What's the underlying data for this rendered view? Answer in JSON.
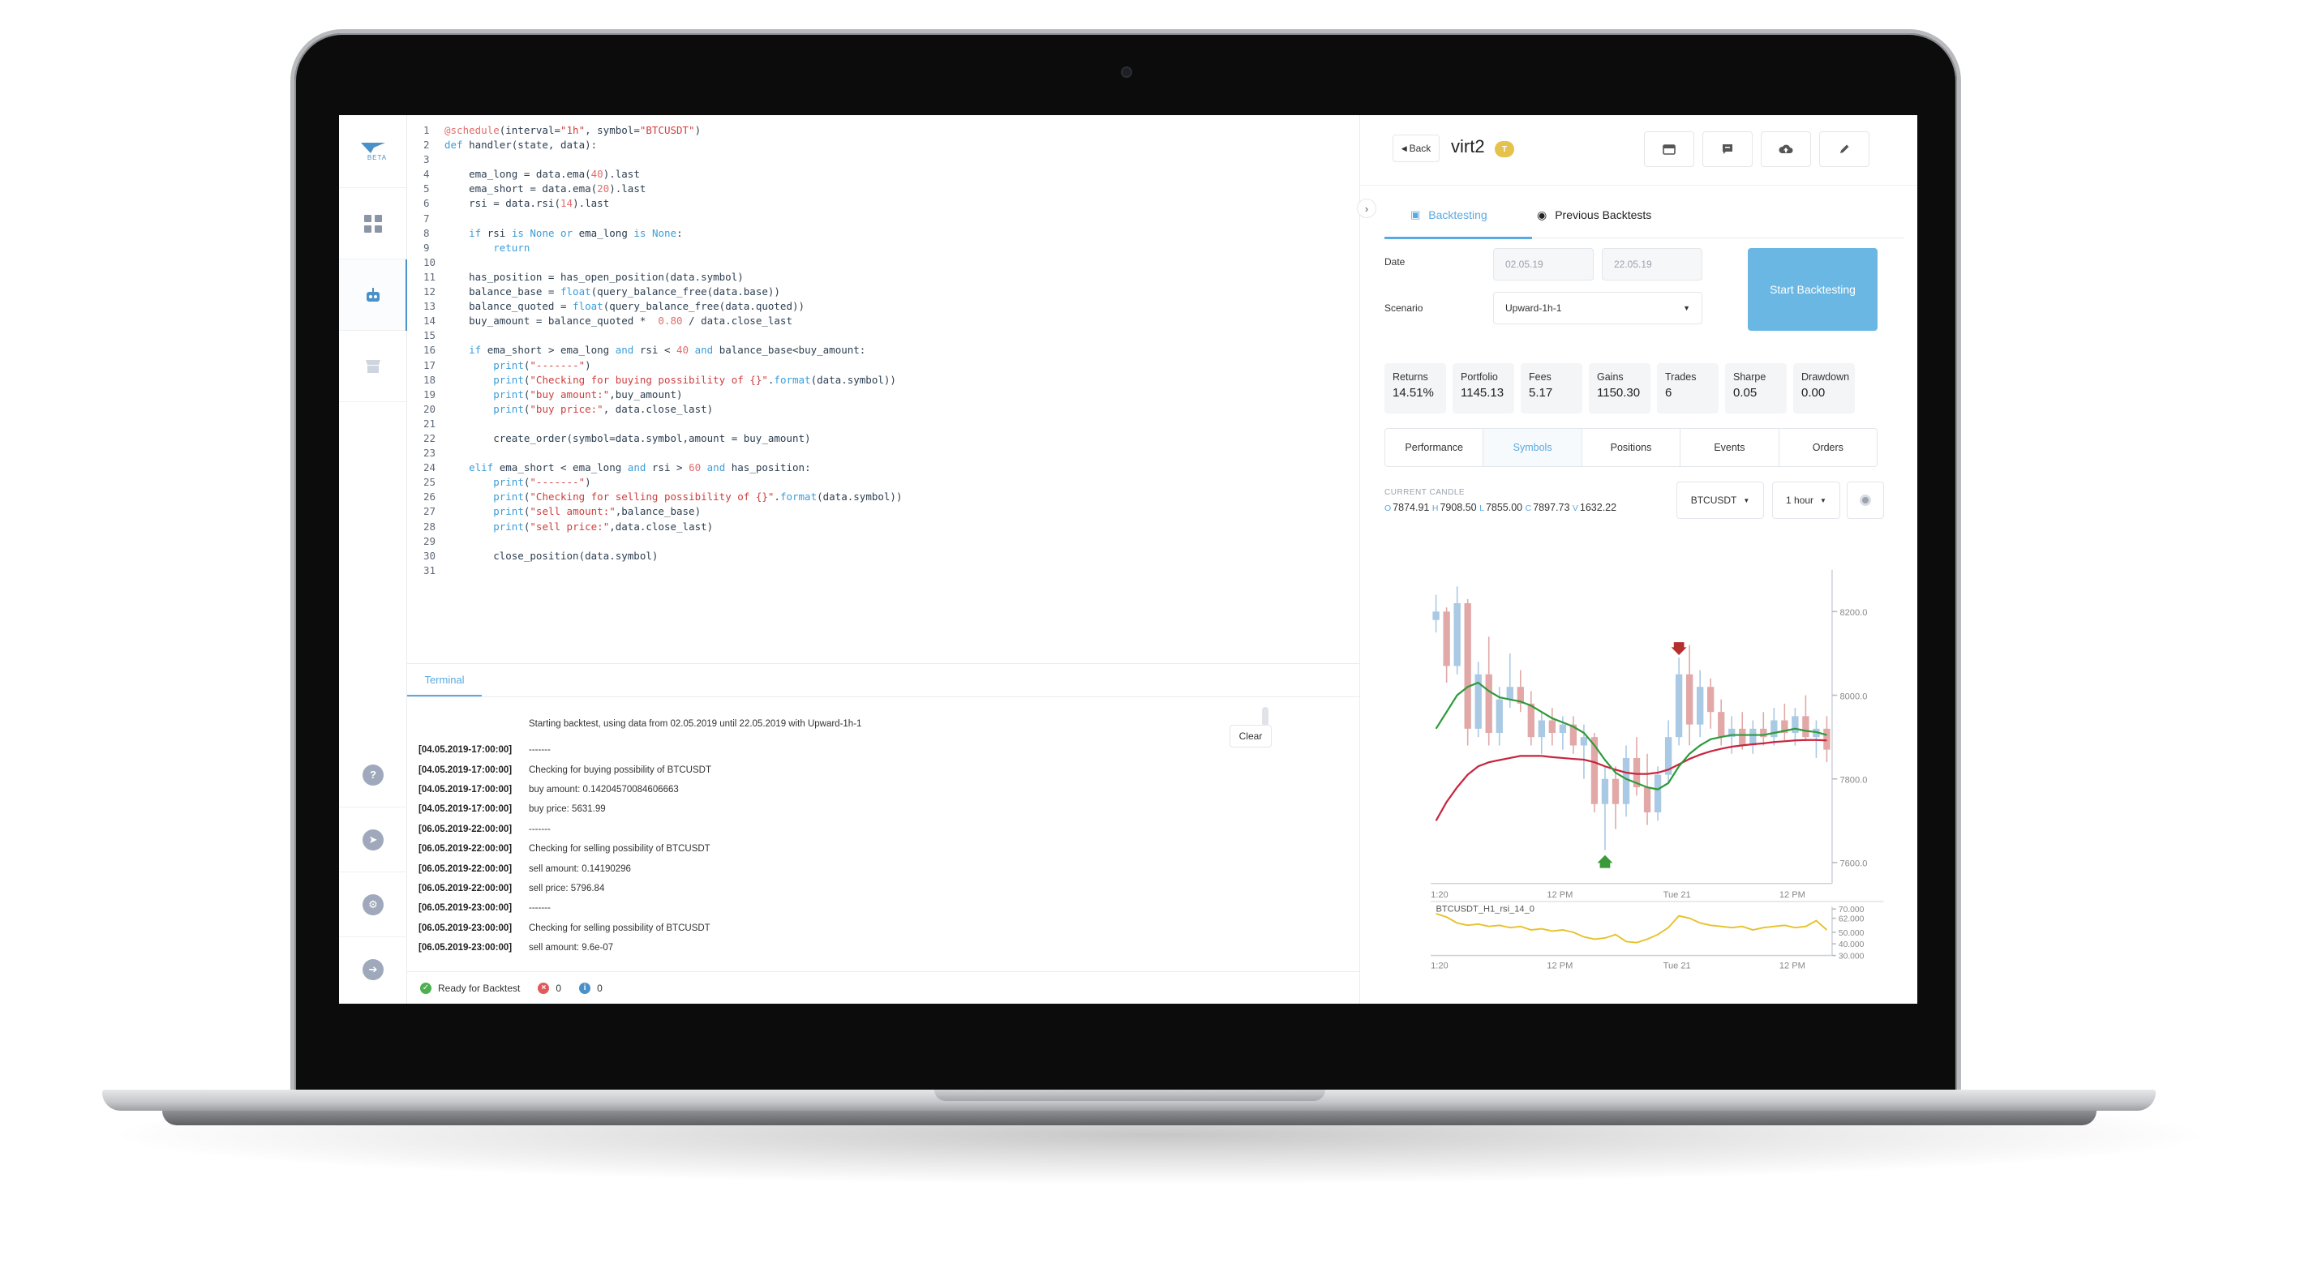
{
  "sidebar": {
    "logo_text": "BETA",
    "items": [
      {
        "icon": "dashboard-grid-icon"
      },
      {
        "icon": "robot-icon"
      },
      {
        "icon": "store-icon"
      }
    ],
    "bottom_items": [
      {
        "icon": "help-icon",
        "glyph": "?"
      },
      {
        "icon": "telegram-icon",
        "glyph": "➤"
      },
      {
        "icon": "settings-icon",
        "glyph": "⚙"
      },
      {
        "icon": "logout-icon",
        "glyph": "➔"
      }
    ]
  },
  "editor": {
    "lines": [
      "@schedule(interval=\"1h\", symbol=\"BTCUSDT\")",
      "def handler(state, data):",
      "",
      "    ema_long = data.ema(40).last",
      "    ema_short = data.ema(20).last",
      "    rsi = data.rsi(14).last",
      "",
      "    if rsi is None or ema_long is None:",
      "        return",
      "",
      "    has_position = has_open_position(data.symbol)",
      "    balance_base = float(query_balance_free(data.base))",
      "    balance_quoted = float(query_balance_free(data.quoted))",
      "    buy_amount = balance_quoted *  0.80 / data.close_last",
      "",
      "    if ema_short > ema_long and rsi < 40 and balance_base<buy_amount:",
      "        print(\"-------\")",
      "        print(\"Checking for buying possibility of {}\".format(data.symbol))",
      "        print(\"buy amount:\",buy_amount)",
      "        print(\"buy price:\", data.close_last)",
      "",
      "        create_order(symbol=data.symbol,amount = buy_amount)",
      "",
      "    elif ema_short < ema_long and rsi > 60 and has_position:",
      "        print(\"-------\")",
      "        print(\"Checking for selling possibility of {}\".format(data.symbol))",
      "        print(\"sell amount:\",balance_base)",
      "        print(\"sell price:\",data.close_last)",
      "",
      "        close_position(data.symbol)",
      ""
    ]
  },
  "terminal": {
    "tab_label": "Terminal",
    "start_message": "Starting backtest, using data from 02.05.2019 until 22.05.2019 with Upward-1h-1",
    "clear_label": "Clear",
    "lines": [
      {
        "ts": "[04.05.2019-17:00:00]",
        "msg": "-------"
      },
      {
        "ts": "[04.05.2019-17:00:00]",
        "msg": "Checking for buying possibility of BTCUSDT"
      },
      {
        "ts": "[04.05.2019-17:00:00]",
        "msg": "buy amount: 0.14204570084606663"
      },
      {
        "ts": "[04.05.2019-17:00:00]",
        "msg": "buy price: 5631.99"
      },
      {
        "ts": "[06.05.2019-22:00:00]",
        "msg": "-------"
      },
      {
        "ts": "[06.05.2019-22:00:00]",
        "msg": "Checking for selling possibility of BTCUSDT"
      },
      {
        "ts": "[06.05.2019-22:00:00]",
        "msg": "sell amount: 0.14190296"
      },
      {
        "ts": "[06.05.2019-22:00:00]",
        "msg": "sell price: 5796.84"
      },
      {
        "ts": "[06.05.2019-23:00:00]",
        "msg": "-------"
      },
      {
        "ts": "[06.05.2019-23:00:00]",
        "msg": "Checking for selling possibility of BTCUSDT"
      },
      {
        "ts": "[06.05.2019-23:00:00]",
        "msg": "sell amount: 9.6e-07"
      }
    ]
  },
  "status": {
    "ready_label": "Ready for Backtest",
    "error_count": "0",
    "info_count": "0",
    "colors": {
      "ok": "#4caf50",
      "error": "#e05a5a",
      "info": "#4a90c9"
    }
  },
  "panel": {
    "back_label": "Back",
    "bot_name": "virt2",
    "bot_badge": "T",
    "toolbar_icons": [
      "calendar-icon",
      "comment-icon",
      "cloud-upload-icon",
      "edit-icon"
    ],
    "tabs": [
      {
        "label": "Backtesting",
        "icon": "backtest-icon",
        "active": true
      },
      {
        "label": "Previous Backtests",
        "icon": "history-icon",
        "active": false
      }
    ],
    "date_label": "Date",
    "date_from": "02.05.19",
    "date_to": "22.05.19",
    "scenario_label": "Scenario",
    "scenario_value": "Upward-1h-1",
    "start_button": "Start Backtesting",
    "metrics": [
      {
        "label": "Returns",
        "value": "14.51%"
      },
      {
        "label": "Portfolio",
        "value": "1145.13"
      },
      {
        "label": "Fees",
        "value": "5.17"
      },
      {
        "label": "Gains",
        "value": "1150.30"
      },
      {
        "label": "Trades",
        "value": "6"
      },
      {
        "label": "Sharpe",
        "value": "0.05"
      },
      {
        "label": "Drawdown",
        "value": "0.00"
      }
    ],
    "subtabs": [
      {
        "label": "Performance",
        "active": false
      },
      {
        "label": "Symbols",
        "active": true
      },
      {
        "label": "Positions",
        "active": false
      },
      {
        "label": "Events",
        "active": false
      },
      {
        "label": "Orders",
        "active": false
      }
    ],
    "candle": {
      "title": "CURRENT CANDLE",
      "o": "7874.91",
      "h": "7908.50",
      "l": "7855.00",
      "c": "7897.73",
      "v": "1632.22",
      "k_o": "O",
      "k_h": "H",
      "k_l": "L",
      "k_c": "C",
      "k_v": "V"
    },
    "symbol_select": "BTCUSDT",
    "interval_select": "1 hour",
    "accent": "#5aa9e0",
    "button_color": "#6bb7e3"
  },
  "chart_data": [
    {
      "type": "candlestick",
      "series": [
        {
          "name": "candles"
        },
        {
          "name": "ema_short",
          "color": "#2e9a3a"
        },
        {
          "name": "ema_long",
          "color": "#c7253e"
        }
      ],
      "ylim": [
        7550,
        8300
      ],
      "y_ticks": [
        "8200.0",
        "8000.0",
        "7800.0",
        "7600.0"
      ],
      "x_ticks": [
        "1:20",
        "12 PM",
        "Tue 21",
        "12 PM"
      ],
      "candles": [
        [
          8180,
          8240,
          8150,
          8200
        ],
        [
          8200,
          8210,
          8030,
          8070
        ],
        [
          8070,
          8260,
          8050,
          8220
        ],
        [
          8220,
          8230,
          7880,
          7920
        ],
        [
          7920,
          8080,
          7900,
          8050
        ],
        [
          8050,
          8140,
          7880,
          7910
        ],
        [
          7910,
          8020,
          7880,
          7990
        ],
        [
          7990,
          8100,
          7970,
          8020
        ],
        [
          8020,
          8060,
          7960,
          7980
        ],
        [
          7980,
          8010,
          7880,
          7900
        ],
        [
          7900,
          7960,
          7860,
          7940
        ],
        [
          7940,
          7970,
          7880,
          7910
        ],
        [
          7910,
          7950,
          7870,
          7930
        ],
        [
          7930,
          7950,
          7860,
          7880
        ],
        [
          7880,
          7930,
          7800,
          7900
        ],
        [
          7900,
          7910,
          7720,
          7740
        ],
        [
          7740,
          7830,
          7630,
          7800
        ],
        [
          7800,
          7830,
          7680,
          7740
        ],
        [
          7740,
          7880,
          7710,
          7850
        ],
        [
          7850,
          7900,
          7760,
          7780
        ],
        [
          7780,
          7860,
          7690,
          7720
        ],
        [
          7720,
          7830,
          7700,
          7810
        ],
        [
          7810,
          7940,
          7790,
          7900
        ],
        [
          7900,
          8090,
          7880,
          8050
        ],
        [
          8050,
          8120,
          7880,
          7930
        ],
        [
          7930,
          8060,
          7900,
          8020
        ],
        [
          8020,
          8040,
          7920,
          7960
        ],
        [
          7960,
          7990,
          7880,
          7900
        ],
        [
          7900,
          7950,
          7860,
          7920
        ],
        [
          7920,
          7960,
          7870,
          7880
        ],
        [
          7880,
          7940,
          7860,
          7920
        ],
        [
          7920,
          7960,
          7880,
          7900
        ],
        [
          7900,
          7970,
          7880,
          7940
        ],
        [
          7940,
          7980,
          7890,
          7910
        ],
        [
          7910,
          7970,
          7880,
          7950
        ],
        [
          7950,
          8000,
          7890,
          7900
        ],
        [
          7900,
          7940,
          7850,
          7920
        ],
        [
          7920,
          7950,
          7840,
          7870
        ]
      ],
      "ema_short": [
        7920,
        7960,
        8000,
        8020,
        8030,
        8010,
        7995,
        7990,
        7985,
        7975,
        7960,
        7945,
        7935,
        7925,
        7910,
        7880,
        7845,
        7815,
        7800,
        7790,
        7780,
        7775,
        7790,
        7830,
        7860,
        7880,
        7895,
        7900,
        7905,
        7905,
        7905,
        7905,
        7910,
        7915,
        7920,
        7915,
        7912,
        7905
      ],
      "ema_long": [
        7700,
        7745,
        7780,
        7810,
        7830,
        7840,
        7845,
        7850,
        7855,
        7855,
        7855,
        7852,
        7850,
        7848,
        7846,
        7840,
        7830,
        7822,
        7815,
        7812,
        7812,
        7815,
        7822,
        7835,
        7848,
        7858,
        7866,
        7872,
        7877,
        7880,
        7883,
        7885,
        7888,
        7890,
        7892,
        7893,
        7893,
        7892
      ],
      "signals": [
        {
          "type": "sell",
          "index": 23
        },
        {
          "type": "buy",
          "index": 16
        }
      ]
    },
    {
      "type": "line",
      "series": [
        {
          "name": "BTCUSDT_H1_rsi_14_0",
          "color": "#e6c229"
        }
      ],
      "ylim": [
        30,
        72
      ],
      "y_ticks": [
        "70.000",
        "62.000",
        "50.000",
        "40.000",
        "30.000"
      ],
      "x_ticks": [
        "1:20",
        "12 PM",
        "Tue 21",
        "12 PM"
      ],
      "values": [
        66,
        63,
        58,
        56,
        57,
        55,
        56,
        54,
        55,
        52,
        53,
        51,
        52,
        50,
        46,
        44,
        45,
        48,
        42,
        41,
        44,
        48,
        54,
        64,
        62,
        58,
        56,
        55,
        54,
        55,
        52,
        54,
        55,
        56,
        54,
        55,
        60,
        52
      ]
    }
  ]
}
